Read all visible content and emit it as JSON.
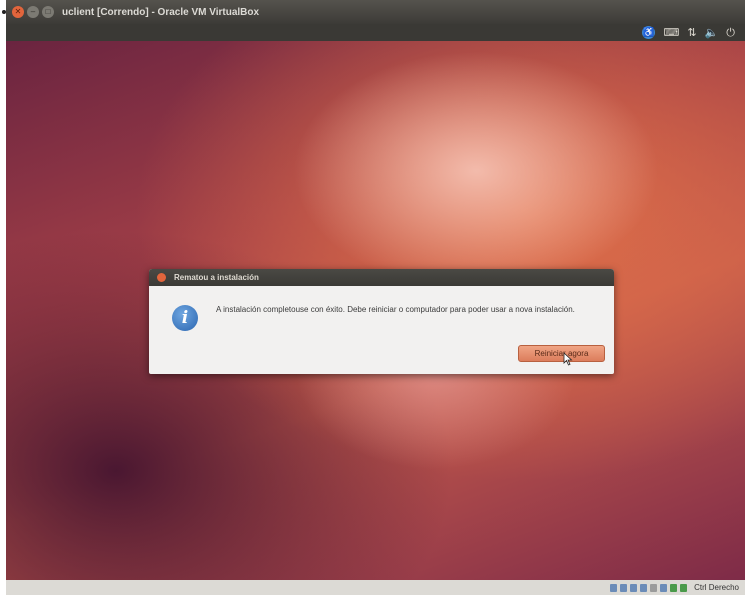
{
  "window": {
    "title": "uclient [Correndo] - Oracle VM VirtualBox",
    "buttons": [
      "close",
      "minimize",
      "maximize"
    ]
  },
  "panel": {
    "icons": [
      "accessibility-icon",
      "keyboard-icon",
      "network-icon",
      "volume-icon",
      "power-icon"
    ]
  },
  "dialog": {
    "title": "Rematou a instalación",
    "message": "A instalación completouse con éxito. Debe reiniciar o computador para poder usar a nova instalación.",
    "button_label": "Reiniciar agora"
  },
  "statusbar": {
    "host_key": "Ctrl Derecho"
  },
  "colors": {
    "accent": "#e2653c",
    "button_primary": "#dc7d5c",
    "info_blue": "#2a65b0"
  }
}
